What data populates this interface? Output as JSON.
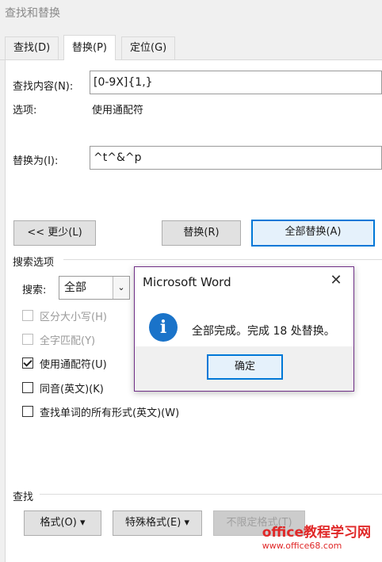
{
  "window": {
    "title": "查找和替换"
  },
  "tabs": [
    {
      "label": "查找(D)"
    },
    {
      "label": "替换(P)"
    },
    {
      "label": "定位(G)"
    }
  ],
  "find": {
    "label": "查找内容(N):",
    "value": "[0-9X]{1,}"
  },
  "options": {
    "label": "选项:",
    "value": "使用通配符"
  },
  "replace": {
    "label": "替换为(I):",
    "value": "^t^&^p"
  },
  "buttons": {
    "less": "<< 更少(L)",
    "replace": "替换(R)",
    "replace_all": "全部替换(A)",
    "format": "格式(O)",
    "special": "特殊格式(E)",
    "no_format": "不限定格式(T)"
  },
  "search_options": {
    "section_label": "搜索选项",
    "search_label": "搜索:",
    "search_value": "全部",
    "checkboxes": [
      {
        "label": "区分大小写(H)",
        "checked": false,
        "disabled": true
      },
      {
        "label": "全字匹配(Y)",
        "checked": false,
        "disabled": true
      },
      {
        "label": "使用通配符(U)",
        "checked": true,
        "disabled": false
      },
      {
        "label": "同音(英文)(K)",
        "checked": false,
        "disabled": false
      },
      {
        "label": "查找单词的所有形式(英文)(W)",
        "checked": false,
        "disabled": false
      }
    ]
  },
  "find_section": {
    "label": "查找"
  },
  "dialog": {
    "title": "Microsoft Word",
    "message": "全部完成。完成 18 处替换。",
    "ok": "确定",
    "icon": "info-icon",
    "close_icon": "close-icon"
  },
  "watermark": {
    "line1": "office教程学习网",
    "line2": "www.office68.com"
  },
  "colors": {
    "accent": "#0078d7",
    "info": "#1a73c9",
    "dialog_border": "#6f2f86",
    "watermark": "#e02828"
  }
}
